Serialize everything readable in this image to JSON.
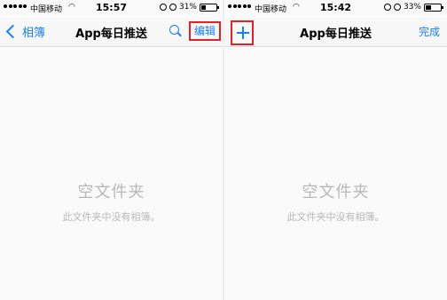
{
  "left": {
    "status": {
      "carrier": "中国移动",
      "time": "15:57",
      "battery_text": "31%",
      "battery_level": 0.31
    },
    "nav": {
      "back_label": "相簿",
      "title": "App每日推送",
      "edit_label": "编辑"
    },
    "empty": {
      "title": "空文件夹",
      "subtitle": "此文件夹中没有相簿。"
    }
  },
  "right": {
    "status": {
      "carrier": "中国移动",
      "time": "15:42",
      "battery_text": "33%",
      "battery_level": 0.33
    },
    "nav": {
      "title": "App每日推送",
      "done_label": "完成"
    },
    "empty": {
      "title": "空文件夹",
      "subtitle": "此文件夹中没有相簿。"
    }
  },
  "colors": {
    "accent": "#1a7ff5",
    "highlight_border": "#e0232a",
    "empty_text": "#b8b8b8"
  },
  "icons": {
    "back": "chevron-left-icon",
    "search": "search-icon",
    "add": "plus-icon",
    "wifi": "wifi-icon",
    "lock": "rotation-lock-icon",
    "alarm": "alarm-icon",
    "battery": "battery-icon"
  }
}
